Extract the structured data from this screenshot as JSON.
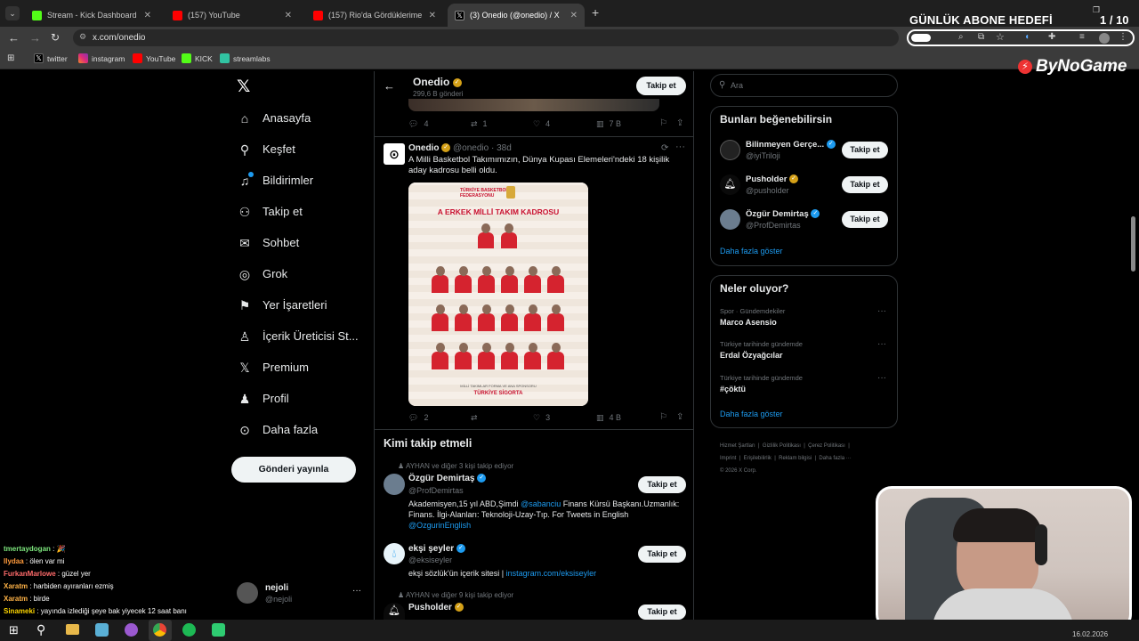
{
  "browser": {
    "tabs": [
      {
        "label": "Stream - Kick Dashboard",
        "color": "#53fc18"
      },
      {
        "label": "(157) YouTube",
        "color": "#ff0000"
      },
      {
        "label": "(157) Rio'da Gördüklerime İnan...",
        "color": "#ff0000"
      },
      {
        "label": "(3) Onedio (@onedio) / X",
        "color": "#000000"
      }
    ],
    "url": "x.com/onedio",
    "bookmarks": [
      "twitter",
      "instagram",
      "YouTube",
      "KICK",
      "streamlabs"
    ]
  },
  "overlay": {
    "goal_title": "GÜNLÜK ABONE HEDEFİ",
    "goal_count": "1 / 10",
    "brand": "ByNoGame",
    "chat": [
      {
        "user": "tmertaydogan",
        "msg": "🎉",
        "color": "#7ee87e"
      },
      {
        "user": "Ilydaa",
        "msg": "ölen var mi",
        "color": "#ff9a3c"
      },
      {
        "user": "FurkanMarlowe",
        "msg": "güzel yer",
        "color": "#ff6b6b"
      },
      {
        "user": "Xaratm",
        "msg": "harbiden ayıranları ezmiş",
        "color": "#ffb347"
      },
      {
        "user": "Xaratm",
        "msg": "birde",
        "color": "#ffb347"
      },
      {
        "user": "Sinameki",
        "msg": "yayında izlediği şeye bak yiyecek 12 saat banı",
        "color": "#ffd700"
      }
    ]
  },
  "nav": {
    "items": [
      "Anasayfa",
      "Keşfet",
      "Bildirimler",
      "Takip et",
      "Sohbet",
      "Grok",
      "Yer İşaretleri",
      "İçerik Üreticisi St...",
      "Premium",
      "Profil",
      "Daha fazla"
    ],
    "post_button": "Gönderi yayınla",
    "account": {
      "name": "nejoli",
      "handle": "@nejoli",
      "more": "···"
    }
  },
  "header": {
    "name": "Onedio",
    "posts": "299,6 B gönderi",
    "follow": "Takip et"
  },
  "prev_stats": {
    "replies": "4",
    "reposts": "1",
    "likes": "4",
    "views": "7 B"
  },
  "tweet": {
    "name": "Onedio",
    "handle": "@onedio",
    "time": "38d",
    "text": "A Milli Basketbol Takımımızın, Dünya Kupası Elemeleri'ndeki 18 kişilik aday kadrosu belli oldu.",
    "image_title": "A ERKEK MİLLİ TAKIM KADROSU",
    "image_org": "TÜRKİYE BASKETBOL FEDERASYONU",
    "image_footer": "MİLLİ TAKIMLAR FORMA VE ANA SPONSORU",
    "image_sponsor": "TÜRKİYE SİGORTA",
    "stats": {
      "replies": "2",
      "reposts": "",
      "likes": "3",
      "views": "4 B"
    }
  },
  "who_to_follow": {
    "title": "Kimi takip etmeli",
    "items": [
      {
        "context": "AYHAN ve diğer 3 kişi takip ediyor",
        "name": "Özgür Demirtaş",
        "handle": "@ProfDemirtas",
        "bio_parts": [
          "Akademisyen,15 yıl ABD,Şimdi ",
          "@sabanciu",
          " Finans Kürsü Başkanı.Uzmanlık: Finans. İlgi-Alanları: Teknoloji-Uzay-Tıp. For Tweets in English ",
          "@OzgurinEnglish"
        ],
        "follow": "Takip et"
      },
      {
        "context": "",
        "name": "ekşi şeyler",
        "handle": "@eksiseyler",
        "bio_parts": [
          "ekşi sözlük'ün içerik sitesi | ",
          "instagram.com/eksiseyler"
        ],
        "follow": "Takip et"
      },
      {
        "context": "AYHAN ve diğer 9 kişi takip ediyor",
        "name": "Pusholder",
        "handle": "",
        "bio_parts": [],
        "follow": "Takip et"
      }
    ]
  },
  "search": {
    "placeholder": "Ara"
  },
  "suggestions": {
    "title": "Bunları beğenebilirsin",
    "items": [
      {
        "name": "Bilinmeyen Gerçe...",
        "handle": "@iyiTriloji",
        "follow": "Takip et"
      },
      {
        "name": "Pusholder",
        "handle": "@pusholder",
        "follow": "Takip et"
      },
      {
        "name": "Özgür Demirtaş",
        "handle": "@ProfDemirtas",
        "follow": "Takip et"
      }
    ],
    "more": "Daha fazla göster"
  },
  "trends": {
    "title": "Neler oluyor?",
    "items": [
      {
        "context": "Spor · Gündemdekiler",
        "name": "Marco Asensio"
      },
      {
        "context": "Türkiye tarihinde gündemde",
        "name": "Erdal Özyağcılar"
      },
      {
        "context": "Türkiye tarihinde gündemde",
        "name": "#çöktü"
      }
    ],
    "more": "Daha fazla göster"
  },
  "footer": {
    "links": [
      "Hizmet Şartları",
      "Gizlilik Politikası",
      "Çerez Politikası",
      "Imprint",
      "Erişilebilirlik",
      "Reklam bilgisi",
      "Daha fazla ···"
    ],
    "copyright": "© 2026 X Corp."
  },
  "taskbar": {
    "date": "16.02.2026"
  }
}
